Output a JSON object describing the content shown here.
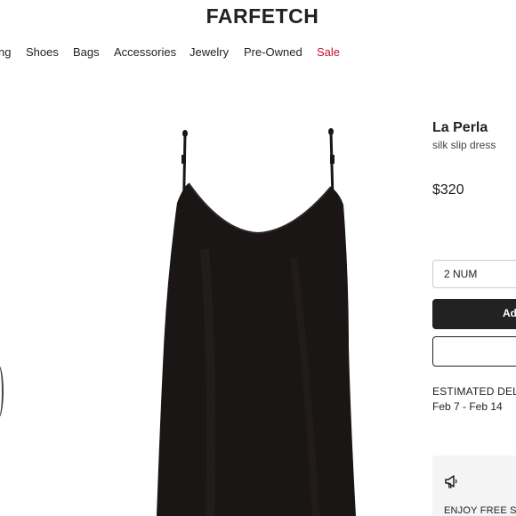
{
  "header": {
    "logo": "FARFETCH"
  },
  "nav": {
    "items": [
      {
        "label": "ng"
      },
      {
        "label": "Shoes"
      },
      {
        "label": "Bags"
      },
      {
        "label": "Accessories"
      },
      {
        "label": "Jewelry"
      },
      {
        "label": "Pre-Owned"
      },
      {
        "label": "Sale"
      }
    ]
  },
  "product": {
    "brand": "La Perla",
    "description": "silk slip dress",
    "price": "$320",
    "size_selected": "2 NUM",
    "add_button_label": "Ad",
    "delivery_label": "ESTIMATED DELIV",
    "delivery_dates": "Feb 7 - Feb 14",
    "promo_text": "ENJOY FREE S",
    "promo_icon": "megaphone-icon",
    "image_icon": "product-image"
  },
  "colors": {
    "sale": "#c8102e",
    "primary_button": "#222222"
  }
}
